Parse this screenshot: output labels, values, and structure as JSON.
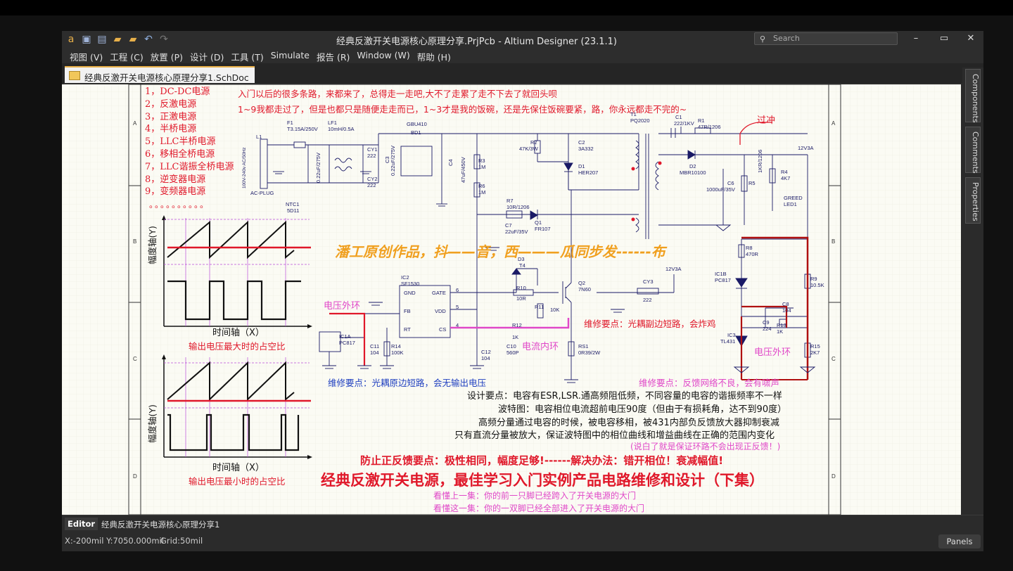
{
  "app": {
    "window_title": "经典反激开关电源核心原理分享.PrjPcb - Altium Designer (23.1.1)",
    "search_placeholder": "Search",
    "menu": [
      "视图 (V)",
      "工程 (C)",
      "放置 (P)",
      "设计 (D)",
      "工具 (T)",
      "Simulate",
      "报告 (R)",
      "Window (W)",
      "帮助 (H)"
    ],
    "doc_tab": "经典反激开关电源核心原理分享1.SchDoc",
    "side_tabs": [
      "Components",
      "Comments",
      "Properties"
    ],
    "editor_label": "Editor",
    "editor_doc": "经典反激开关电源核心原理分享1",
    "status_coord": "X:-200mil Y:7050.000mil",
    "status_grid": "Grid:50mil",
    "panels_label": "Panels"
  },
  "schematic": {
    "border_rows": [
      "A",
      "B",
      "C",
      "D"
    ],
    "list_items": [
      "1，DC-DC电源",
      "2，反激电源",
      "3，正激电源",
      "4，半桥电源",
      "5，LLC半桥电源",
      "6，移相全桥电源",
      "7，LLC谐振全桥电源",
      "8，逆变器电源",
      "9，变频器电源"
    ],
    "dots": "。。。。。。。。。。",
    "headline1": "入门以后的很多条路，来都来了，总得走一走吧,大不了走累了走不下去了就回头呗",
    "headline2": "1~9我都走过了，但是也都只是随便走走而已，1~3才是我的饭碗，还是先保住饭碗要紧，路，你永远都走不完的~",
    "overshoot": "过冲",
    "watermark": "潘工原创作品，抖——音，西———瓜同步发------布",
    "chart1_ylabel": "幅度轴(Y)",
    "chart1_xlabel": "时间轴（X）",
    "chart1_caption": "输出电压最大时的占空比",
    "chart2_ylabel": "幅度轴(Y)",
    "chart2_xlabel": "时间轴（X）",
    "chart2_caption": "输出电压最小时的占空比",
    "voltage_outer_left": "电压外环",
    "voltage_outer_right": "电压外环",
    "current_inner": "电流内环",
    "repair1": "维修要点：光耦副边短路，会炸鸡",
    "repair2": "维修要点：光耦原边短路，会无输出电压",
    "repair3": "维修要点：反馈网络不良，会有啸声",
    "design1": "设计要点：电容有ESR,LSR.通高频阻低频，不同容量的电容的谐振频率不一样",
    "design2": "波特图：电容相位电流超前电压90度（但由于有损耗角，达不到90度）",
    "design3": "高频分量通过电容的时候，被电容移相，被431内部负反馈放大器抑制衰减",
    "design4": "只有直流分量被放大，保证波特图中的相位曲线和增益曲线在正确的范围内变化",
    "design5": "(说白了就是保证环路不会出现正反馈！)",
    "prevent": "防止正反馈要点：极性相同，幅度足够!------解决办法：错开相位！衰减幅值!",
    "big_title": "经典反激开关电源，最佳学习入门实例产品电路维修和设计（下集）",
    "ep_prev": "看懂上一集：你的前一只脚已经跨入了开关电源的大门",
    "ep_this": "看懂这一集：你的一双脚已经全部进入了开关电源的大门",
    "parts": {
      "L1": "L1",
      "AC-PLUG": "AC-PLUG",
      "L1v": "100V-240v AC/50Hz",
      "F1": "F1",
      "F1v": "T3.15A/250V",
      "LF1": "LF1",
      "LF1v": "10mH/0.5A",
      "NTC1": "NTC1",
      "NTC1v": "5D11",
      "CX": "0.22uF/275V",
      "CY1": "CY1",
      "CY1v": "222",
      "CY2": "CY2",
      "CY2v": "222",
      "C3": "C3",
      "C3v": "0.22uF/275V",
      "BD1": "BD1",
      "GBU": "GBU410",
      "C4": "C4",
      "C4v": "47uF/450V",
      "R3": "R3",
      "R3v": "1M",
      "R6": "R6",
      "R6v": "1M",
      "R2": "R2",
      "R2v": "47K/3W",
      "C2": "C2",
      "C2v": "3A332",
      "D1": "D1",
      "D1v": "HER207",
      "T1": "T1",
      "T1v": "PQ2020",
      "C1": "C1",
      "C1v": "222/1KV",
      "R1": "R1",
      "R1v": "47R/1206",
      "D2": "D2",
      "D2v": "MBR10100",
      "C6": "C6",
      "C6v": "1000uF/35V",
      "R5": "R5",
      "R5v": "1KR/1206",
      "R4": "R4",
      "R4v": "4K7",
      "LED1": "GREED LED1",
      "out": "12V3A",
      "R7": "R7",
      "R7v": "10R/1206",
      "Q1": "Q1",
      "Q1v": "FR107",
      "C7": "C7",
      "C7v": "22uF/35V",
      "IC2": "IC2",
      "IC2v": "SF1530",
      "GND": "GND",
      "GATE": "GATE",
      "FB": "FB",
      "VDD": "VDD",
      "RT": "RT",
      "CS": "CS",
      "p6": "6",
      "p5": "5",
      "p4": "4",
      "D3": "D3",
      "D3v": "T4",
      "R10": "R10",
      "R10v": "10R",
      "R11": "R11",
      "R11v": "10K",
      "Q2": "Q2",
      "Q2v": "7N60",
      "R12": "R12",
      "R12v": "1K",
      "C10": "C10",
      "C10v": "560P",
      "RS1": "RS1",
      "RS1v": "0R39/2W",
      "C12": "C12",
      "C12v": "104",
      "C11": "C11",
      "C11v": "104",
      "R14": "R14",
      "R14v": "100K",
      "IC1A": "IC1A",
      "IC1Av": "PC817",
      "CY3": "CY3",
      "CY3v": "222",
      "out2": "12V3A",
      "R8": "R8",
      "R8v": "470R",
      "IC1B": "IC1B",
      "IC1Bv": "PC817",
      "R9": "R9",
      "R9v": "10.5K",
      "C8": "C8",
      "C8v": "104",
      "C9": "C9",
      "C9v": "224",
      "R13": "R13",
      "R13v": "1K",
      "IC3": "IC3",
      "IC3v": "TL431",
      "R15": "R15",
      "R15v": "2K7"
    }
  }
}
